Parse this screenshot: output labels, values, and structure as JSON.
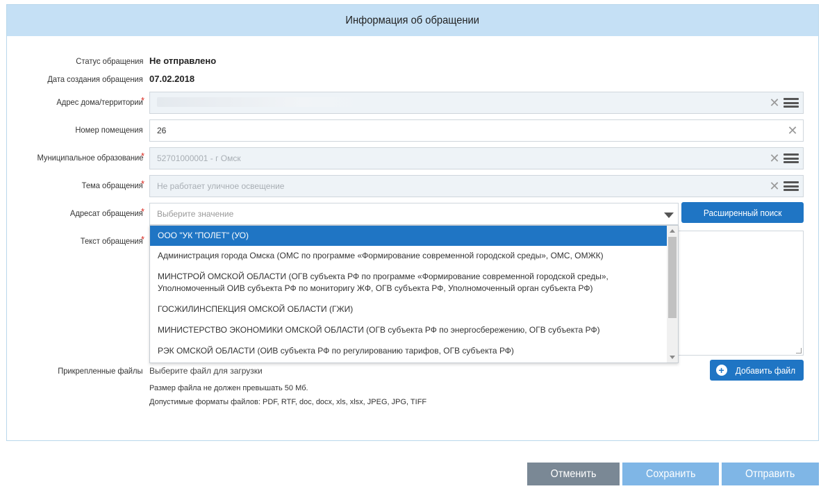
{
  "panel": {
    "title": "Информация об обращении"
  },
  "form": {
    "status": {
      "label": "Статус обращения",
      "value": "Не отправлено"
    },
    "created": {
      "label": "Дата создания обращения",
      "value": "07.02.2018"
    },
    "address": {
      "label": "Адрес дома/территории",
      "required": "*"
    },
    "room": {
      "label": "Номер помещения",
      "value": "26"
    },
    "municipality": {
      "label": "Муниципальное образование",
      "required": "*",
      "value": "52701000001 - г Омск"
    },
    "topic": {
      "label": "Тема обращения",
      "required": "*",
      "value": "Не работает уличное освещение"
    },
    "addressee": {
      "label": "Адресат обращения",
      "required": "*",
      "placeholder": "Выберите значение"
    },
    "text": {
      "label": "Текст обращения",
      "required": "*"
    },
    "files": {
      "label": "Прикрепленные файлы",
      "choose": "Выберите файл для загрузки",
      "size_note": "Размер файла не должен превышать 50 Мб.",
      "formats_note": "Допустимые форматы файлов: PDF, RTF, doc, docx, xls, xlsx, JPEG, JPG, TIFF"
    }
  },
  "buttons": {
    "advanced_search": "Расширенный поиск",
    "add_file": "Добавить файл",
    "cancel": "Отменить",
    "save": "Сохранить",
    "send": "Отправить"
  },
  "dropdown": {
    "options": [
      "ООО \"УК \"ПОЛЕТ\" (УО)",
      "Администрация города Омска (ОМС по программе «Формирование современной городской среды», ОМС, ОМЖК)",
      "МИНСТРОЙ ОМСКОЙ ОБЛАСТИ (ОГВ субъекта РФ по программе «Формирование современной городской среды»,",
      "Уполномоченный ОИВ субъекта РФ по мониторигу ЖФ, ОГВ субъекта РФ, Уполномоченный орган субъекта РФ)",
      "ГОСЖИЛИНСПЕКЦИЯ ОМСКОЙ ОБЛАСТИ (ГЖИ)",
      "МИНИСТЕРСТВО ЭКОНОМИКИ ОМСКОЙ ОБЛАСТИ (ОГВ субъекта РФ по энергосбережению, ОГВ субъекта РФ)",
      "РЭК ОМСКОЙ ОБЛАСТИ (ОИВ субъекта РФ по регулированию тарифов, ОГВ субъекта РФ)"
    ],
    "selected_index": 0
  },
  "icons": {
    "clear": "close-icon",
    "menu": "list-menu-icon",
    "caret": "chevron-down-icon",
    "add": "plus-circle-icon"
  },
  "colors": {
    "header_bg": "#c5e0f5",
    "primary": "#1f75c4",
    "cancel_bg": "#7a8895",
    "disabled_blue": "#7fb6e6",
    "required": "#d9261c"
  }
}
